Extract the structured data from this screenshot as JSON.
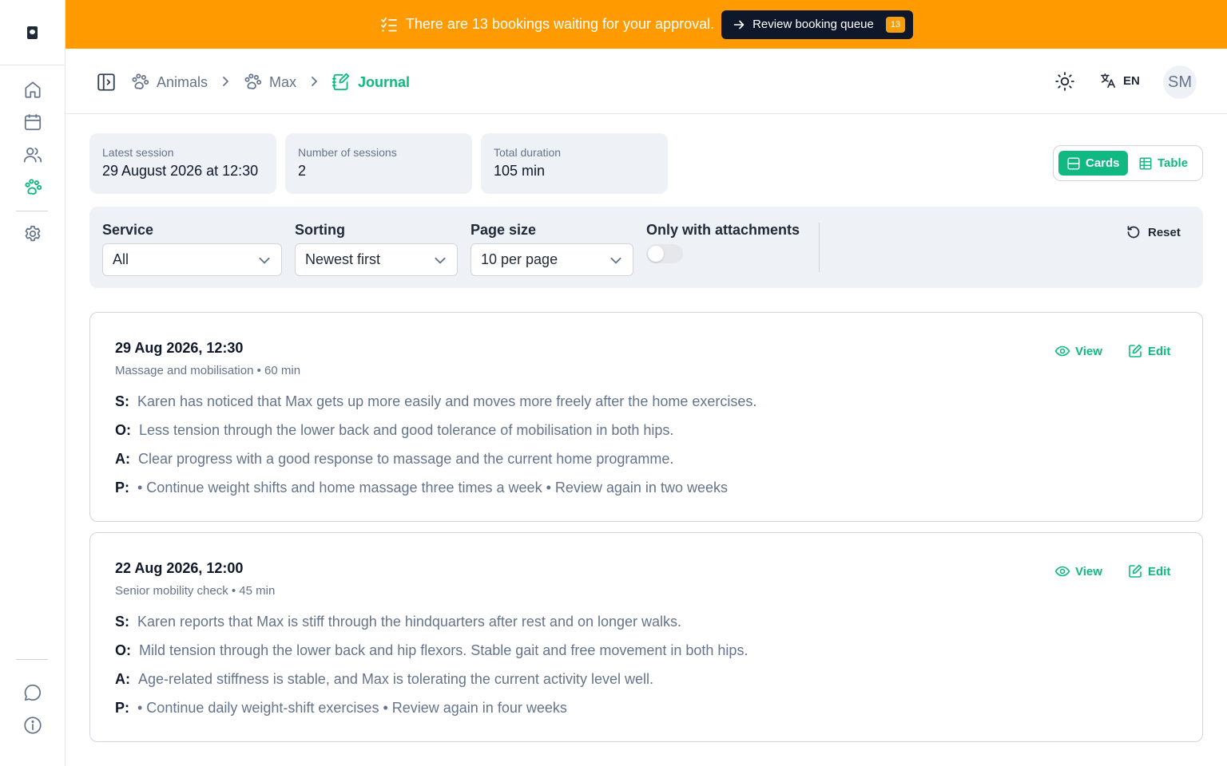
{
  "sidebar": {
    "items": [
      {
        "icon": "home-icon"
      },
      {
        "icon": "calendar-icon"
      },
      {
        "icon": "users-icon"
      },
      {
        "icon": "paw-icon",
        "active": true
      },
      {
        "icon": "gear-icon"
      },
      {
        "icon": "chat-icon"
      },
      {
        "icon": "info-icon"
      }
    ]
  },
  "banner": {
    "message": "There are 13 bookings waiting for your approval.",
    "button_label": "Review booking queue",
    "count": "13"
  },
  "breadcrumb": {
    "items": [
      "Animals",
      "Max",
      "Journal"
    ]
  },
  "header": {
    "language": "EN",
    "avatar_initials": "SM"
  },
  "stats": [
    {
      "label": "Latest session",
      "value": "29 August 2026 at 12:30"
    },
    {
      "label": "Number of sessions",
      "value": "2"
    },
    {
      "label": "Total duration",
      "value": "105 min"
    }
  ],
  "view_toggle": {
    "cards_label": "Cards",
    "table_label": "Table",
    "selected": "Cards"
  },
  "filters": {
    "service_label": "Service",
    "service_value": "All",
    "sorting_label": "Sorting",
    "sorting_value": "Newest first",
    "page_size_label": "Page size",
    "page_size_value": "10 per page",
    "attachments_label": "Only with attachments",
    "attachments_on": false,
    "reset_label": "Reset"
  },
  "entry_actions": {
    "view_label": "View",
    "edit_label": "Edit"
  },
  "entries": [
    {
      "date": "29 Aug 2026, 12:30",
      "subtitle": "Massage and mobilisation • 60 min",
      "soap": [
        {
          "key": "S:",
          "text": "Karen has noticed that Max gets up more easily and moves more freely after the home exercises."
        },
        {
          "key": "O:",
          "text": "Less tension through the lower back and good tolerance of mobilisation in both hips."
        },
        {
          "key": "A:",
          "text": "Clear progress with a good response to massage and the current home programme."
        },
        {
          "key": "P:",
          "text": "• Continue weight shifts and home massage three times a week • Review again in two weeks"
        }
      ]
    },
    {
      "date": "22 Aug 2026, 12:00",
      "subtitle": "Senior mobility check • 45 min",
      "soap": [
        {
          "key": "S:",
          "text": "Karen reports that Max is stiff through the hindquarters after rest and on longer walks."
        },
        {
          "key": "O:",
          "text": "Mild tension through the lower back and hip flexors. Stable gait and free movement in both hips."
        },
        {
          "key": "A:",
          "text": "Age-related stiffness is stable, and Max is tolerating the current activity level well."
        },
        {
          "key": "P:",
          "text": "• Continue daily weight-shift exercises • Review again in four weeks"
        }
      ]
    }
  ],
  "colors": {
    "accent": "#10b981",
    "banner": "#ff9b00",
    "queue_badge": "#f59e0b"
  }
}
